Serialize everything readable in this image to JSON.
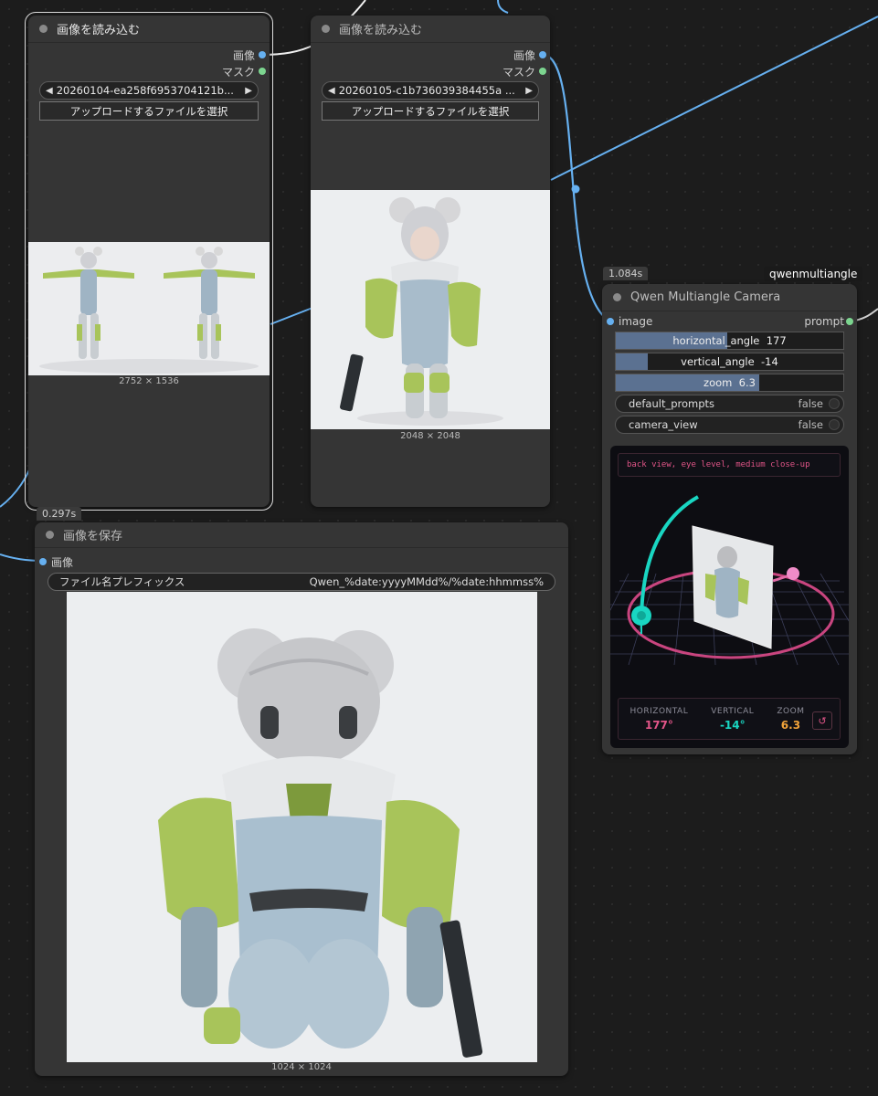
{
  "colors": {
    "canvas_bg": "#1c1c1c",
    "node_bg": "#353535",
    "link_image": "#66b0f0",
    "link_prompt": "#7cd58f",
    "cam_accent_pink": "#e25588",
    "cam_accent_teal": "#19d6c2",
    "cam_accent_orange": "#f2a33a"
  },
  "load_node_1": {
    "title": "画像を読み込む",
    "outputs": [
      "画像",
      "マスク"
    ],
    "file": "20260104-ea258f6953704121b...",
    "upload_label": "アップロードするファイルを選択",
    "dimensions": "2752 × 1536"
  },
  "load_node_2": {
    "title": "画像を読み込む",
    "outputs": [
      "画像",
      "マスク"
    ],
    "file": "20260105-c1b736039384455a ...",
    "upload_label": "アップロードするファイルを選択",
    "dimensions": "2048 × 2048"
  },
  "save_node": {
    "time_badge": "0.297s",
    "title": "画像を保存",
    "input": "画像",
    "prefix_label": "ファイル名プレフィックス",
    "prefix_value": "Qwen_%date:yyyyMMdd%/%date:hhmmss%",
    "dimensions": "1024 × 1024"
  },
  "camera_node": {
    "time_badge": "1.084s",
    "name_badge": "qwenmultiangle",
    "title": "Qwen Multiangle Camera",
    "input": "image",
    "output": "prompt",
    "widgets": {
      "horizontal_angle": {
        "label": "horizontal_angle",
        "value": "177",
        "fraction": 0.49
      },
      "vertical_angle": {
        "label": "vertical_angle",
        "value": "-14",
        "fraction": 0.14
      },
      "zoom": {
        "label": "zoom",
        "value": "6.3",
        "fraction": 0.63
      },
      "default_prompts": {
        "label": "default_prompts",
        "value": "false"
      },
      "camera_view": {
        "label": "camera_view",
        "value": "false"
      }
    },
    "prompt_text": "back view, eye level, medium close-up",
    "stats": {
      "horizontal_label": "HORIZONTAL",
      "horizontal_value": "177°",
      "vertical_label": "VERTICAL",
      "vertical_value": "-14°",
      "zoom_label": "ZOOM",
      "zoom_value": "6.3"
    }
  }
}
